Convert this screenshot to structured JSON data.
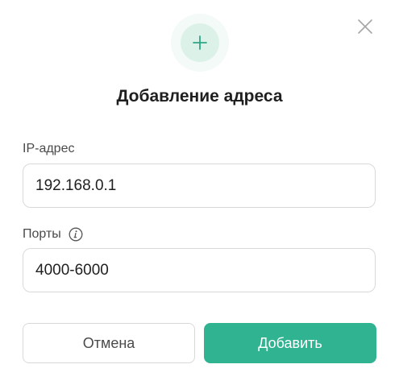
{
  "dialog": {
    "title": "Добавление адреса",
    "icon": "plus-icon",
    "close_icon": "close-icon",
    "accent_color": "#2fb391"
  },
  "fields": {
    "ip": {
      "label": "IP-адрес",
      "value": "192.168.0.1"
    },
    "ports": {
      "label": "Порты",
      "info_icon": "info-icon",
      "value": "4000-6000"
    }
  },
  "actions": {
    "cancel_label": "Отмена",
    "submit_label": "Добавить"
  }
}
